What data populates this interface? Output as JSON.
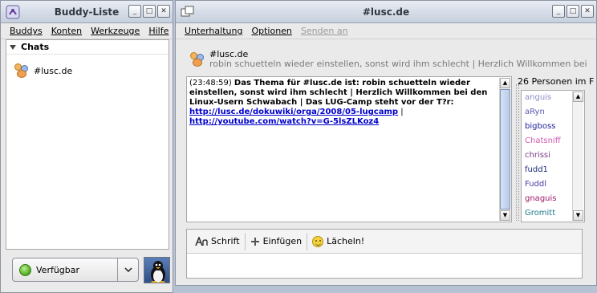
{
  "buddy_window": {
    "title": "Buddy-Liste",
    "menu": [
      "Buddys",
      "Konten",
      "Werkzeuge",
      "Hilfe"
    ],
    "group_label": "Chats",
    "chats": [
      {
        "label": "#lusc.de"
      }
    ],
    "status": {
      "label": "Verfügbar",
      "color": "#4aa91b"
    }
  },
  "chat_window": {
    "title": "#lusc.de",
    "menu": [
      {
        "label": "Unterhaltung",
        "disabled": false
      },
      {
        "label": "Optionen",
        "disabled": false
      },
      {
        "label": "Senden an",
        "disabled": true
      }
    ],
    "conversation_name": "#lusc.de",
    "topic": "robin schuetteln wieder einstellen, sonst wird ihm schlecht | Herzlich Willkommen bei den Linux...",
    "message": {
      "time": "(23:48:59)",
      "text": "Das Thema für #lusc.de ist: robin schuetteln wieder einstellen, sonst wird ihm schlecht | Herzlich Willkommen bei den Linux-Usern Schwabach | Das LUG-Camp steht vor der T?r:",
      "link1": "http://lusc.de/dokuwiki/orga/2008/05-lugcamp",
      "separator": "|",
      "link2": "http://youtube.com/watch?v=G-5lsZLKoz4"
    },
    "user_count_label": "26 Personen im F",
    "users": [
      {
        "name": "anguis",
        "color": "#8a8ac8"
      },
      {
        "name": "aRyn",
        "color": "#5a5ab8"
      },
      {
        "name": "bigboss",
        "color": "#1c1c9a"
      },
      {
        "name": "Chatsniff",
        "color": "#d05ab0"
      },
      {
        "name": "chrissi",
        "color": "#7a3a8a"
      },
      {
        "name": "fudd1",
        "color": "#1a2a7a"
      },
      {
        "name": "Fuddl",
        "color": "#4a3aa0"
      },
      {
        "name": "gnaguis",
        "color": "#a01a6a"
      },
      {
        "name": "Gromitt",
        "color": "#1a7a8a"
      }
    ],
    "toolbar": {
      "font_label": "Schrift",
      "insert_label": "Einfügen",
      "smile_label": "Lächeln!"
    }
  },
  "titlebar_buttons": {
    "minimize": "_",
    "maximize": "□",
    "close": "✕"
  }
}
